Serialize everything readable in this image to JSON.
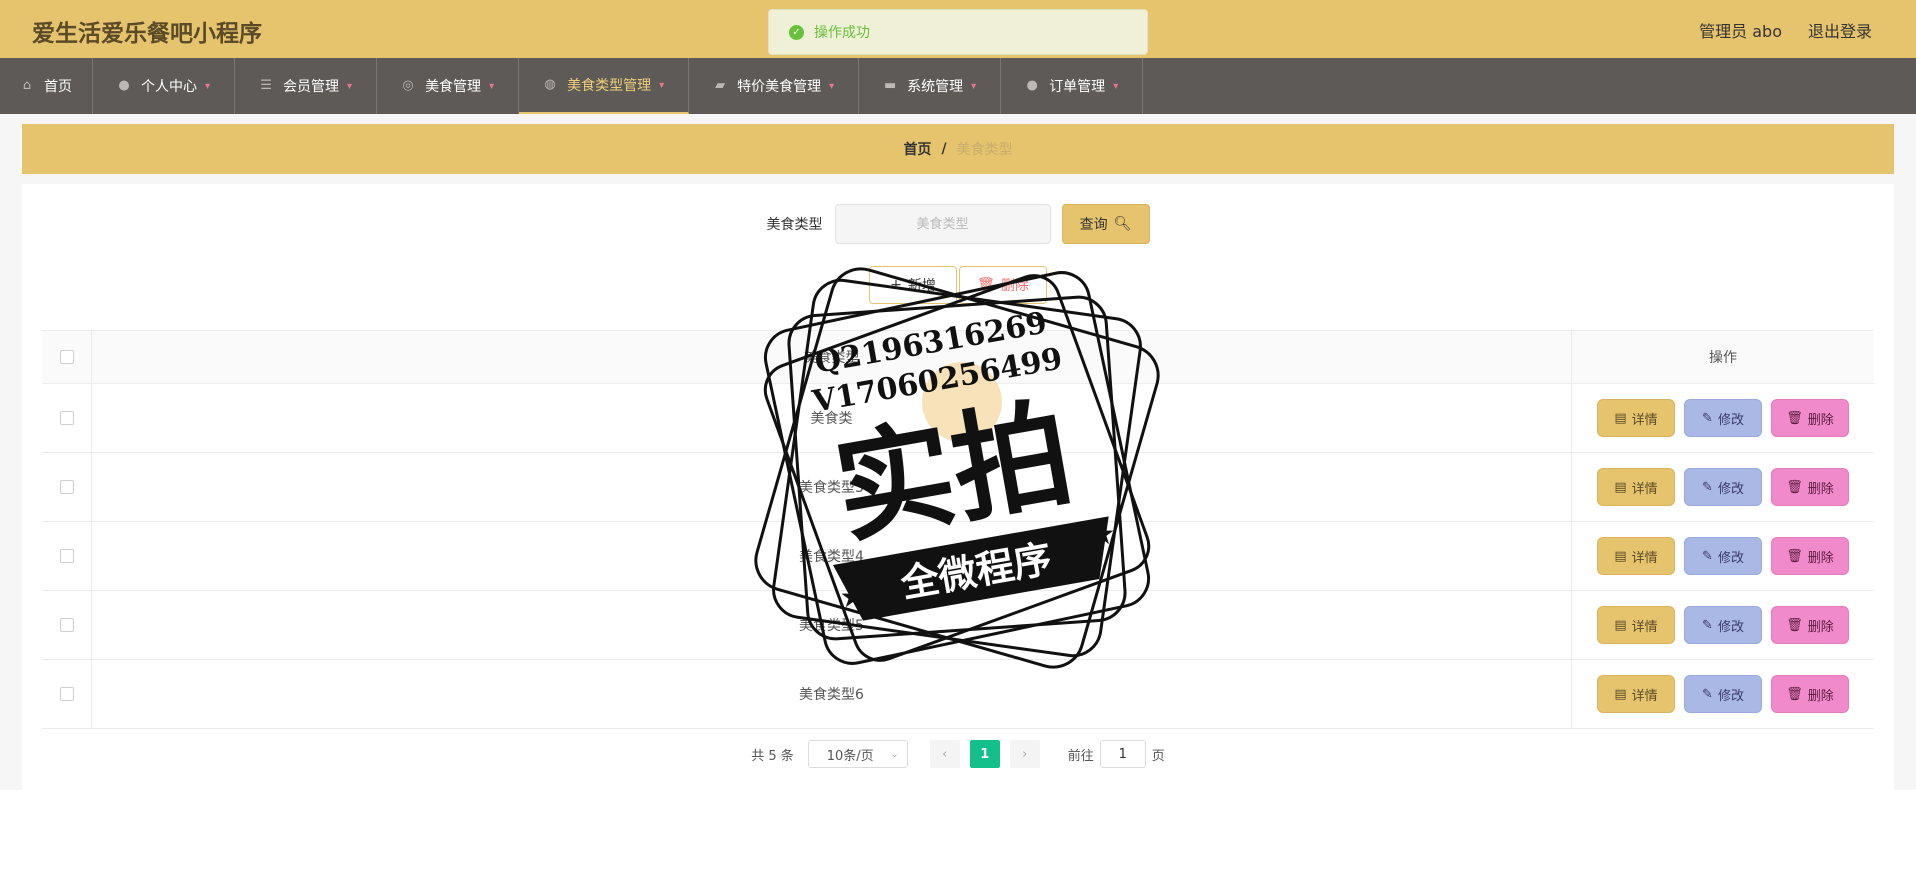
{
  "app": {
    "title": "爱生活爱乐餐吧小程序"
  },
  "user": {
    "label": "管理员 abo",
    "logout": "退出登录"
  },
  "toast": {
    "message": "操作成功"
  },
  "nav": [
    {
      "label": "首页",
      "icon": "home-icon",
      "caret": false
    },
    {
      "label": "个人中心",
      "icon": "user-icon",
      "caret": true
    },
    {
      "label": "会员管理",
      "icon": "sliders-icon",
      "caret": true
    },
    {
      "label": "美食管理",
      "icon": "compass-icon",
      "caret": true
    },
    {
      "label": "美食类型管理",
      "icon": "globe-icon",
      "caret": true,
      "active": true
    },
    {
      "label": "特价美食管理",
      "icon": "wallet-icon",
      "caret": true
    },
    {
      "label": "系统管理",
      "icon": "ticket-icon",
      "caret": true
    },
    {
      "label": "订单管理",
      "icon": "user-icon",
      "caret": true
    }
  ],
  "breadcrumb": {
    "home": "首页",
    "separator": "/",
    "current": "美食类型"
  },
  "search": {
    "label": "美食类型",
    "placeholder": "美食类型",
    "value": "",
    "button": "查询"
  },
  "actions": {
    "add": "新增",
    "delete": "删除"
  },
  "table": {
    "columns": {
      "type": "美食类型",
      "ops": "操作"
    },
    "rows": [
      {
        "type": "美食类"
      },
      {
        "type": "美食类型3"
      },
      {
        "type": "美食类型4"
      },
      {
        "type": "美食类型5"
      },
      {
        "type": "美食类型6"
      }
    ],
    "ops": {
      "detail": "详情",
      "edit": "修改",
      "delete": "删除"
    }
  },
  "pagination": {
    "total": "共 5 条",
    "page_size": "10条/页",
    "current_page": "1",
    "goto_label": "前往",
    "goto_value": "1",
    "page_suffix": "页"
  },
  "watermark": {
    "line1": "Q2196316269",
    "line2": "V17060256499",
    "big": "实拍",
    "ribbon": "全微程序"
  },
  "colors": {
    "header": "#e6c46e",
    "navbar": "#5e5a57",
    "active_page": "#14c08a",
    "edit": "#aab8e6",
    "delete": "#f08acb"
  }
}
